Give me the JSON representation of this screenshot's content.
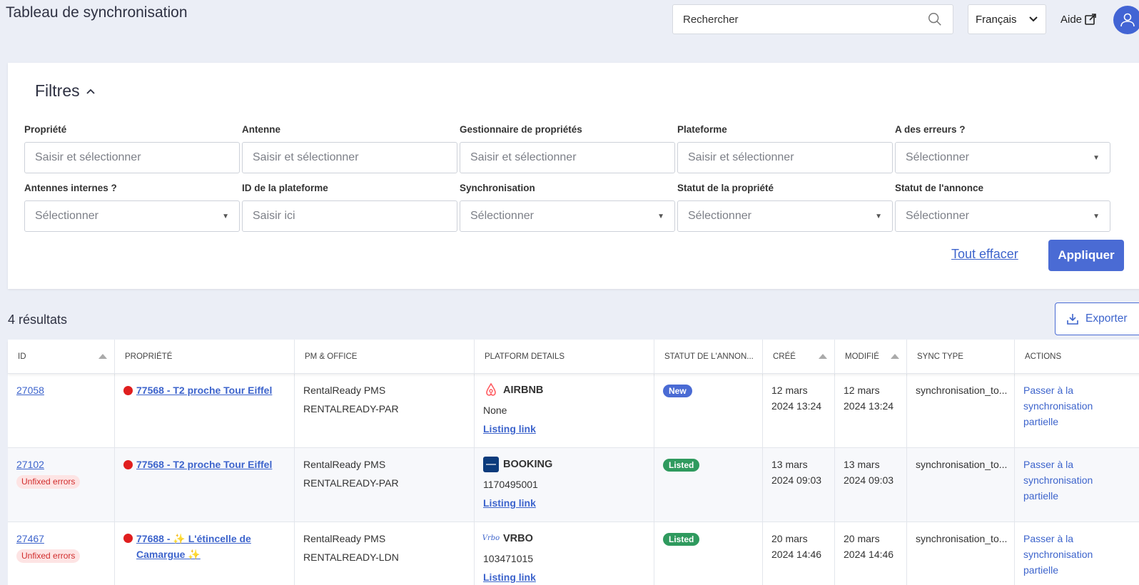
{
  "header": {
    "title": "Tableau de synchronisation",
    "search_placeholder": "Rechercher",
    "language": "Français",
    "help_label": "Aide"
  },
  "filters": {
    "title": "Filtres",
    "fields": [
      {
        "label": "Propriété",
        "placeholder": "Saisir et sélectionner",
        "kind": "input"
      },
      {
        "label": "Antenne",
        "placeholder": "Saisir et sélectionner",
        "kind": "input"
      },
      {
        "label": "Gestionnaire de propriétés",
        "placeholder": "Saisir et sélectionner",
        "kind": "input"
      },
      {
        "label": "Plateforme",
        "placeholder": "Saisir et sélectionner",
        "kind": "input"
      },
      {
        "label": "A des erreurs ?",
        "placeholder": "Sélectionner",
        "kind": "select"
      },
      {
        "label": "Antennes internes ?",
        "placeholder": "Sélectionner",
        "kind": "select"
      },
      {
        "label": "ID de la plateforme",
        "placeholder": "Saisir ici",
        "kind": "input"
      },
      {
        "label": "Synchronisation",
        "placeholder": "Sélectionner",
        "kind": "select"
      },
      {
        "label": "Statut de la propriété",
        "placeholder": "Sélectionner",
        "kind": "select"
      },
      {
        "label": "Statut de l'annonce",
        "placeholder": "Sélectionner",
        "kind": "select"
      }
    ],
    "clear_label": "Tout effacer",
    "apply_label": "Appliquer"
  },
  "results": {
    "count_label": "4 résultats",
    "export_label": "Exporter"
  },
  "table": {
    "columns": [
      "ID",
      "PROPRIÉTÉ",
      "PM & OFFICE",
      "PLATFORM DETAILS",
      "STATUT DE L'ANNON...",
      "CRÉÉ",
      "MODIFIÉ",
      "SYNC TYPE",
      "ACTIONS"
    ],
    "rows": [
      {
        "id": "27058",
        "error": "",
        "property_1": "77568 - T2 proche Tour Eiffel",
        "property_2": "",
        "pm": "RentalReady PMS",
        "office": "RENTALREADY-PAR",
        "platform": "AIRBNB",
        "platform_icon": "airbnb-logo",
        "platform_id": "None",
        "listing_link": "Listing link",
        "status": "New",
        "status_color": "#4a6bd4",
        "created_1": "12 mars",
        "created_2": "2024 13:24",
        "modified_1": "12 mars",
        "modified_2": "2024 13:24",
        "sync_type": "synchronisation_to...",
        "action_1": "Passer à la",
        "action_2": "synchronisation",
        "action_3": "partielle"
      },
      {
        "id": "27102",
        "error": "Unfixed errors",
        "property_1": "77568 - T2 proche Tour Eiffel",
        "property_2": "",
        "pm": "RentalReady PMS",
        "office": "RENTALREADY-PAR",
        "platform": "BOOKING",
        "platform_icon": "booking-logo",
        "platform_id": "1170495001",
        "listing_link": "Listing link",
        "status": "Listed",
        "status_color": "#2f9a5e",
        "created_1": "13 mars",
        "created_2": "2024 09:03",
        "modified_1": "13 mars",
        "modified_2": "2024 09:03",
        "sync_type": "synchronisation_to...",
        "action_1": "Passer à la",
        "action_2": "synchronisation",
        "action_3": "partielle"
      },
      {
        "id": "27467",
        "error": "Unfixed errors",
        "property_1": "77688 - ✨ L'étincelle de",
        "property_2": "Camargue ✨",
        "pm": "RentalReady PMS",
        "office": "RENTALREADY-LDN",
        "platform": "VRBO",
        "platform_icon": "vrbo-logo",
        "platform_id": "103471015",
        "listing_link": "Listing link",
        "status": "Listed",
        "status_color": "#2f9a5e",
        "created_1": "20 mars",
        "created_2": "2024 14:46",
        "modified_1": "20 mars",
        "modified_2": "2024 14:46",
        "sync_type": "synchronisation_to...",
        "action_1": "Passer à la",
        "action_2": "synchronisation",
        "action_3": "partielle"
      }
    ]
  },
  "colors": {
    "accent": "#4a6bd4",
    "error_dot": "#e01e1e",
    "background": "#ebeef6"
  }
}
